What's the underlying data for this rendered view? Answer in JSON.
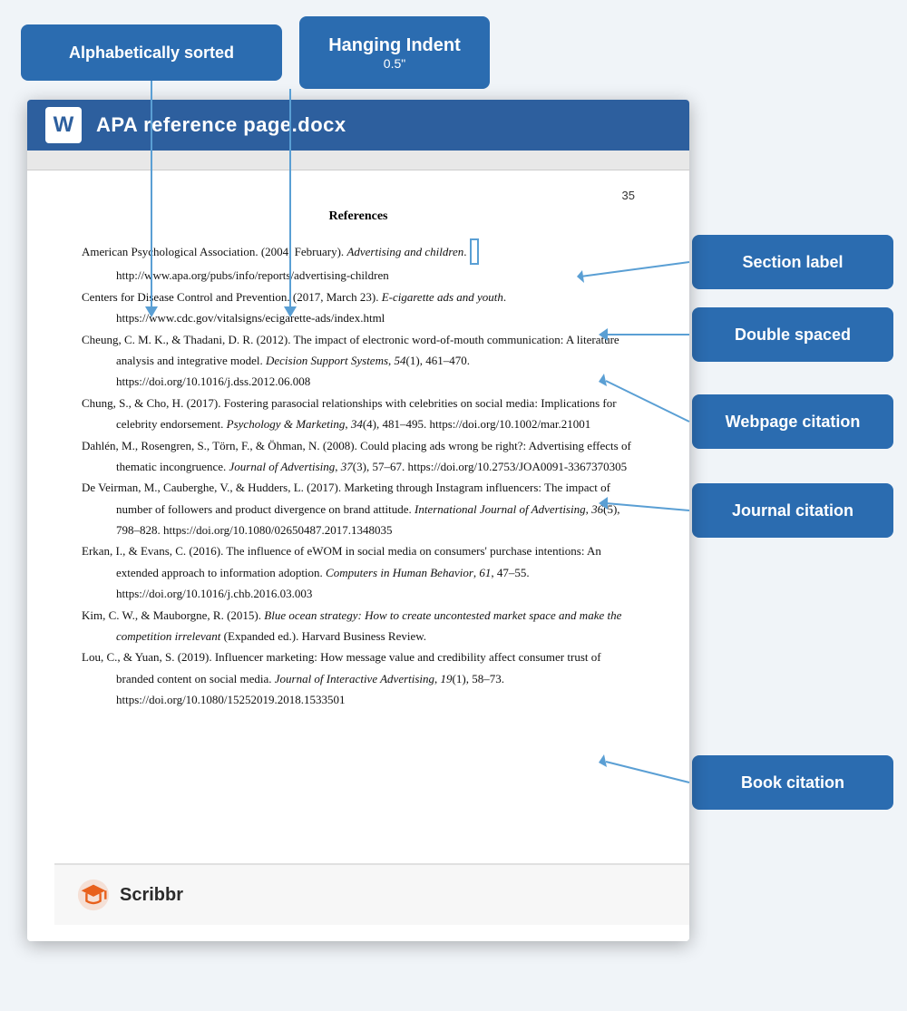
{
  "badges": {
    "alpha": "Alphabetically sorted",
    "indent_title": "Hanging Indent",
    "indent_sub": "0.5\"",
    "section": "Section label",
    "double": "Double spaced",
    "webpage": "Webpage citation",
    "journal": "Journal citation",
    "book": "Book citation"
  },
  "doc": {
    "title": "APA reference page.docx",
    "page_number": "35",
    "references_heading": "References",
    "entries": [
      {
        "id": "entry1",
        "text": "American Psychological Association. (2004, February). Advertising and children. http://www.apa.org/pubs/info/reports/advertising-children",
        "italic_parts": [
          "Advertising and children"
        ]
      },
      {
        "id": "entry2",
        "text": "Centers for Disease Control and Prevention. (2017, March 23). E-cigarette ads and youth. https://www.cdc.gov/vitalsigns/ecigarette-ads/index.html",
        "italic_parts": [
          "E-cigarette ads and youth"
        ]
      },
      {
        "id": "entry3",
        "text": "Cheung, C. M. K., & Thadani, D. R. (2012). The impact of electronic word-of-mouth communication: A literature analysis and integrative model. Decision Support Systems, 54(1), 461–470. https://doi.org/10.1016/j.dss.2012.06.008",
        "italic_parts": [
          "Decision Support Systems,"
        ]
      },
      {
        "id": "entry4",
        "text": "Chung, S., & Cho, H. (2017). Fostering parasocial relationships with celebrities on social media: Implications for celebrity endorsement. Psychology & Marketing, 34(4), 481–495. https://doi.org/10.1002/mar.21001",
        "italic_parts": [
          "Psychology & Marketing,"
        ]
      },
      {
        "id": "entry5",
        "text": "Dahlén, M., Rosengren, S., Törn, F., & Öhman, N. (2008). Could placing ads wrong be right?: Advertising effects of thematic incongruence. Journal of Advertising, 37(3), 57–67. https://doi.org/10.2753/JOA0091-3367370305",
        "italic_parts": [
          "Journal of Advertising,"
        ]
      },
      {
        "id": "entry6",
        "text": "De Veirman, M., Cauberghe, V., & Hudders, L. (2017). Marketing through Instagram influencers: The impact of number of followers and product divergence on brand attitude. International Journal of Advertising, 36(5), 798–828. https://doi.org/10.1080/02650487.2017.1348035",
        "italic_parts": [
          "International Journal of Advertising,"
        ]
      },
      {
        "id": "entry7",
        "text": "Erkan, I., & Evans, C. (2016). The influence of eWOM in social media on consumers' purchase intentions: An extended approach to information adoption. Computers in Human Behavior, 61, 47–55. https://doi.org/10.1016/j.chb.2016.03.003",
        "italic_parts": [
          "Computers in Human Behavior,"
        ]
      },
      {
        "id": "entry8",
        "text": "Kim, C. W., & Mauborgne, R. (2015). Blue ocean strategy: How to create uncontested market space and make the competition irrelevant (Expanded ed.). Harvard Business Review.",
        "italic_parts": [
          "Blue ocean strategy: How to create uncontested market space and make the competition irrelevant"
        ]
      },
      {
        "id": "entry9",
        "text": "Lou, C., & Yuan, S. (2019). Influencer marketing: How message value and credibility affect consumer trust of branded content on social media. Journal of Interactive Advertising, 19(1), 58–73. https://doi.org/10.1080/15252019.2018.1533501",
        "italic_parts": [
          "Journal of Interactive Advertising,"
        ]
      }
    ]
  },
  "footer": {
    "brand": "Scribbr"
  }
}
